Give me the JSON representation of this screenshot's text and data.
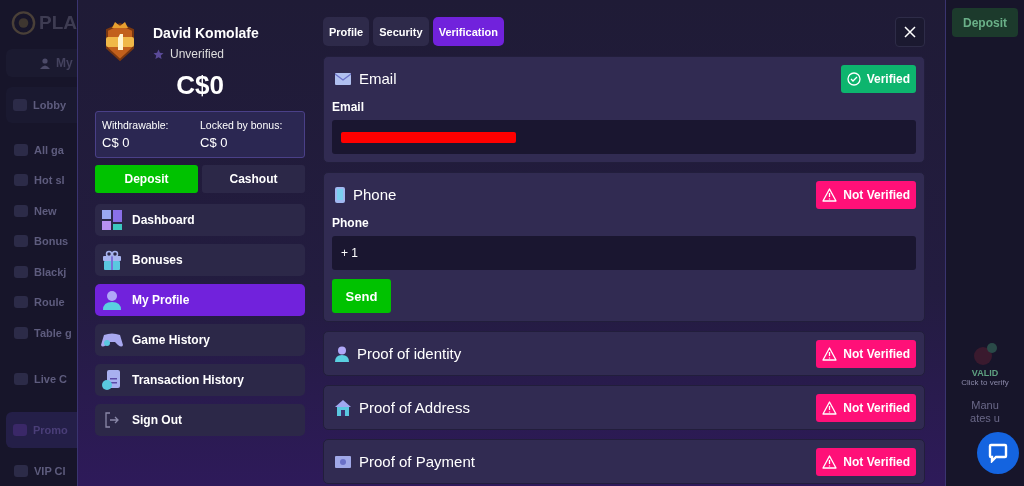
{
  "background": {
    "logo_text": "PLA",
    "my_button": "My",
    "nav": [
      {
        "label": "Lobby",
        "selected": false
      },
      {
        "label": "All ga",
        "selected": false
      },
      {
        "label": "Hot sl",
        "selected": false
      },
      {
        "label": "New",
        "selected": false
      },
      {
        "label": "Bonus",
        "selected": false
      },
      {
        "label": "Blackj",
        "selected": false
      },
      {
        "label": "Roule",
        "selected": false
      },
      {
        "label": "Table g",
        "selected": false
      },
      {
        "label": "Live C",
        "selected": false
      },
      {
        "label": "Promo",
        "selected": true
      },
      {
        "label": "VIP Cl",
        "selected": false
      }
    ],
    "deposit_button": "Deposit",
    "valid_label": "VALID",
    "valid_hint": "Click to verify",
    "text_1": "Manu",
    "text_2": "ates u"
  },
  "profile": {
    "name": "David Komolafe",
    "status": "Unverified",
    "balance": "C$0",
    "withdrawable_label": "Withdrawable:",
    "withdrawable": "C$ 0",
    "locked_label": "Locked by bonus:",
    "locked": "C$ 0",
    "deposit_button": "Deposit",
    "cashout_button": "Cashout",
    "menu": [
      {
        "label": "Dashboard",
        "selected": false
      },
      {
        "label": "Bonuses",
        "selected": false
      },
      {
        "label": "My Profile",
        "selected": true
      },
      {
        "label": "Game History",
        "selected": false
      },
      {
        "label": "Transaction History",
        "selected": false
      },
      {
        "label": "Sign Out",
        "selected": false
      }
    ]
  },
  "tabs": [
    {
      "label": "Profile",
      "selected": false
    },
    {
      "label": "Security",
      "selected": false
    },
    {
      "label": "Verification",
      "selected": true
    }
  ],
  "sections": [
    {
      "kind": "email",
      "title": "Email",
      "verified": true,
      "status_label": "Verified",
      "field_label": "Email",
      "redacted": true
    },
    {
      "kind": "phone",
      "title": "Phone",
      "verified": false,
      "status_label": "Not Verified",
      "field_label": "Phone",
      "value": "+ 1",
      "button": "Send"
    },
    {
      "kind": "identity",
      "title": "Proof of identity",
      "verified": false,
      "status_label": "Not Verified"
    },
    {
      "kind": "address",
      "title": "Proof of Address",
      "verified": false,
      "status_label": "Not Verified"
    },
    {
      "kind": "payment",
      "title": "Proof of Payment",
      "verified": false,
      "status_label": "Not Verified"
    }
  ]
}
